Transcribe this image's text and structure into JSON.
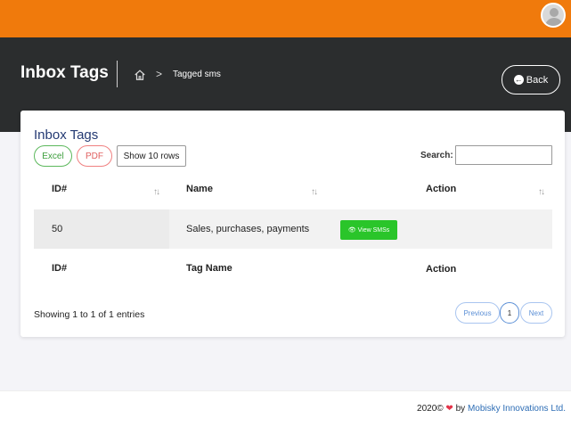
{
  "topbar": {
    "avatar_icon": "user-avatar-icon",
    "color": "#f07a0c"
  },
  "header": {
    "title": "Inbox Tags",
    "breadcrumb": {
      "home_icon": "home-icon",
      "separator": ">",
      "current": "Tagged sms"
    },
    "back_label": "Back",
    "color": "#2b2d2e"
  },
  "card": {
    "title": "Inbox Tags",
    "buttons": {
      "excel": "Excel",
      "pdf": "PDF",
      "rows": "Show 10 rows"
    },
    "search": {
      "label": "Search:",
      "value": ""
    },
    "table": {
      "header": [
        "ID#",
        "Name",
        "Action"
      ],
      "rows": [
        {
          "id": "50",
          "name": "Sales, purchases, payments",
          "action": "View SMSs"
        }
      ],
      "footer": [
        "ID#",
        "Tag Name",
        "Action"
      ]
    },
    "info": "Showing 1 to 1 of 1 entries",
    "pagination": {
      "previous": "Previous",
      "current": "1",
      "next": "Next"
    }
  },
  "footer": {
    "year": "2020©",
    "by": "by",
    "company": "Mobisky Innovations Ltd."
  },
  "colors": {
    "accent_orange": "#f07a0c",
    "green": "#2ac52a",
    "link_blue": "#2d6db5",
    "title_navy": "#243a73"
  }
}
